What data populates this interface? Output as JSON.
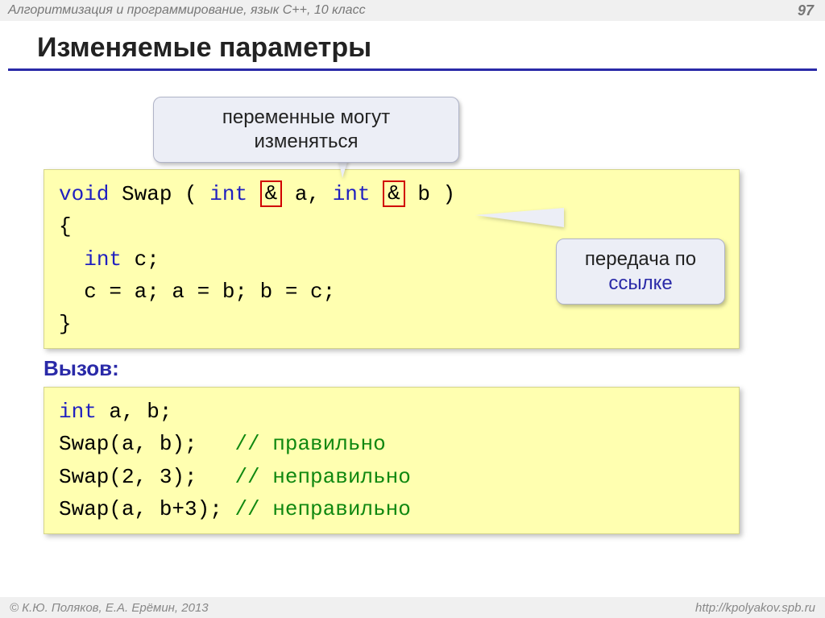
{
  "header": {
    "course": "Алгоритмизация и программирование, язык  C++, 10 класс",
    "page": "97"
  },
  "title": "Изменяемые параметры",
  "callout1": "переменные могут изменяться",
  "callout2": {
    "line1": "передача по",
    "ref": "ссылке"
  },
  "code1": {
    "void": "void",
    "swap": " Swap ( ",
    "int1": "int",
    "sp1": " ",
    "amp1": "&",
    "a": " a, ",
    "int2": "int",
    "sp2": " ",
    "amp2": "&",
    "b": " b )",
    "open": "{",
    "indent": "  ",
    "intc": "int",
    "cdecl": " c;",
    "body": "  c = a; a = b; b = c;",
    "close": "}"
  },
  "call_label": "Вызов:",
  "code2": {
    "int": "int",
    "decl": " a, b;",
    "l2a": "Swap(a, b);   ",
    "l2b": "// правильно",
    "l3a": "Swap(2, 3);   ",
    "l3b": "// неправильно",
    "l4a": "Swap(a, b+3); ",
    "l4b": "// неправильно"
  },
  "footer": {
    "left": "© К.Ю. Поляков, Е.А. Ерёмин, 2013",
    "right": "http://kpolyakov.spb.ru"
  }
}
